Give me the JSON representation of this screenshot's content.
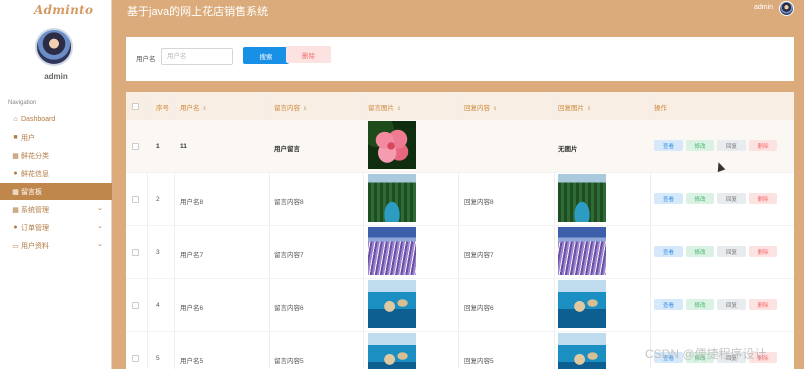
{
  "brand": "Adminto",
  "user": {
    "name": "admin"
  },
  "header": {
    "title": "基于java的网上花店销售系统",
    "user_name": "admin"
  },
  "nav": {
    "title": "Navigation",
    "items": [
      {
        "label": "Dashboard",
        "icon": "home-icon"
      },
      {
        "label": "用户",
        "icon": "user-icon"
      },
      {
        "label": "鲜花分类",
        "icon": "grid-icon"
      },
      {
        "label": "鲜花信息",
        "icon": "person-icon"
      },
      {
        "label": "留言板",
        "icon": "grid-icon",
        "active": true
      },
      {
        "label": "系统管理",
        "icon": "grid-icon",
        "expandable": true
      },
      {
        "label": "订单管理",
        "icon": "person-icon",
        "expandable": true
      },
      {
        "label": "用户资料",
        "icon": "card-icon",
        "expandable": true
      }
    ]
  },
  "search": {
    "label": "用户名",
    "placeholder": "用户名",
    "search_label": "搜索",
    "delete_label": "删除"
  },
  "table": {
    "headers": {
      "index": "序号",
      "username": "用户名",
      "content": "留言内容",
      "picture": "留言图片",
      "reply": "回复内容",
      "reply_picture": "回复图片",
      "actions": "操作"
    },
    "rows": [
      {
        "index": "1",
        "username": "11",
        "content": "用户留言",
        "picture": "flower",
        "reply": "",
        "reply_picture_text": "无图片"
      },
      {
        "index": "2",
        "username": "用户名8",
        "content": "留言内容8",
        "picture": "forest",
        "reply": "回复内容8",
        "reply_picture": "forest"
      },
      {
        "index": "3",
        "username": "用户名7",
        "content": "留言内容7",
        "picture": "lavender",
        "reply": "回复内容7",
        "reply_picture": "lavender"
      },
      {
        "index": "4",
        "username": "用户名6",
        "content": "留言内容6",
        "picture": "sea",
        "reply": "回复内容6",
        "reply_picture": "sea"
      },
      {
        "index": "5",
        "username": "用户名5",
        "content": "留言内容5",
        "picture": "sea",
        "reply": "回复内容5",
        "reply_picture": "sea"
      }
    ],
    "actions": {
      "view": "查看",
      "edit": "修改",
      "reply": "回复",
      "delete": "删除"
    }
  },
  "watermark": "CSDN @便捷程序设计"
}
